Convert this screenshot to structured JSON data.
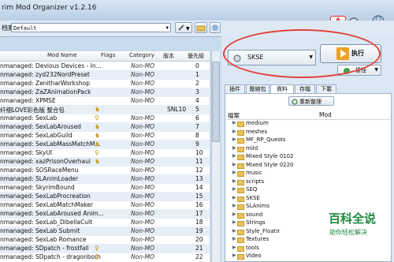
{
  "app": {
    "title": "rim Mod Organizer v1.2.16"
  },
  "toolbar": {
    "profile_label": "档案",
    "profile_value": "Default"
  },
  "grid": {
    "headers": {
      "name": "Mod Name",
      "flags": "Flags",
      "category": "Category",
      "version": "版本",
      "priority": "優先級"
    },
    "rows": [
      {
        "name": "nmanaged: Devious Devices - In...",
        "flag": "",
        "category": "Non-MO",
        "version": "",
        "priority": "0"
      },
      {
        "name": "nmanaged: zyd232NordPreset",
        "flag": "",
        "category": "Non-MO",
        "version": "",
        "priority": "1"
      },
      {
        "name": "nmanaged: ZenitharWorkshop",
        "flag": "",
        "category": "Non-MO",
        "version": "",
        "priority": "2"
      },
      {
        "name": "nmanaged: ZaZAnimationPack",
        "flag": "",
        "category": "Non-MO",
        "version": "",
        "priority": "3"
      },
      {
        "name": "nmanaged: XPMSE",
        "flag": "",
        "category": "Non-MO",
        "version": "",
        "priority": "4"
      },
      {
        "name": "纤细LOVE彩色版 整合包",
        "flag": "♞",
        "category": "",
        "version": "SNL10",
        "priority": "5"
      },
      {
        "name": "nmanaged: SexLab",
        "flag": "♀",
        "category": "Non-MO",
        "version": "",
        "priority": "6"
      },
      {
        "name": "nmanaged: SexLabAroused",
        "flag": "♞",
        "category": "Non-MO",
        "version": "",
        "priority": "7"
      },
      {
        "name": "nmanaged: SexLabGuild",
        "flag": "♞",
        "category": "Non-MO",
        "version": "",
        "priority": "8"
      },
      {
        "name": "nmanaged: SexLabMassMatchM...",
        "flag": "♞",
        "category": "Non-MO",
        "version": "",
        "priority": "9"
      },
      {
        "name": "nmanaged: SkyUI",
        "flag": "♀",
        "category": "Non-MO",
        "version": "",
        "priority": "10"
      },
      {
        "name": "nmanaged: xazPrisonOverhaul",
        "flag": "♞",
        "category": "Non-MO",
        "version": "",
        "priority": "11"
      },
      {
        "name": "nmanaged: SOSRaceMenu",
        "flag": "",
        "category": "Non-MO",
        "version": "",
        "priority": "12"
      },
      {
        "name": "nmanaged: SLAnimLoader",
        "flag": "",
        "category": "Non-MO",
        "version": "",
        "priority": "13"
      },
      {
        "name": "nmanaged: SkyrimBound",
        "flag": "",
        "category": "Non-MO",
        "version": "",
        "priority": "14"
      },
      {
        "name": "nmanaged: SexLabProcreation",
        "flag": "",
        "category": "Non-MO",
        "version": "",
        "priority": "15"
      },
      {
        "name": "nmanaged: SexLabMatchMaker",
        "flag": "",
        "category": "Non-MO",
        "version": "",
        "priority": "16"
      },
      {
        "name": "nmanaged: SexLabAroused Anim...",
        "flag": "",
        "category": "Non-MO",
        "version": "",
        "priority": "17"
      },
      {
        "name": "nmanaged: SexLab_DibellaCult",
        "flag": "",
        "category": "Non-MO",
        "version": "",
        "priority": "18"
      },
      {
        "name": "nmanaged: SexLab Submit",
        "flag": "",
        "category": "Non-MO",
        "version": "",
        "priority": "19"
      },
      {
        "name": "nmanaged: SexLab Romance",
        "flag": "",
        "category": "Non-MO",
        "version": "",
        "priority": "20"
      },
      {
        "name": "nmanaged: SDpatch - frostfall",
        "flag": "♀",
        "category": "Non-MO",
        "version": "",
        "priority": "21"
      },
      {
        "name": "nmanaged: SDpatch - dragonborn",
        "flag": "♀",
        "category": "Non-MO",
        "version": "",
        "priority": "22"
      }
    ]
  },
  "right": {
    "executable": "SKSE",
    "run_label": "执行",
    "shortcut_label": "捷徑",
    "tabs": [
      "插件",
      "壓縮包",
      "資料",
      "存檔",
      "下載"
    ],
    "active_tab": 2,
    "refresh_label": "重新整理",
    "data_headers": {
      "name": "檔案",
      "mod": "Mod"
    },
    "data_items": [
      "medium",
      "meshes",
      "MF_RP_Quests",
      "mild",
      "Mixed Style 0102",
      "Mixed Style 0220",
      "music",
      "scripts",
      "SEQ",
      "SKSE",
      "SLAnims",
      "sound",
      "Strings",
      "Style_Floatir",
      "Textures",
      "tools",
      "Video"
    ]
  },
  "watermark": {
    "big": "百科全说",
    "small": "助你轻松解决"
  },
  "colors": {
    "highlight_ellipse": "#e0403a",
    "flag_gold": "#c79a22",
    "watermark_green": "#1f8a3d"
  }
}
